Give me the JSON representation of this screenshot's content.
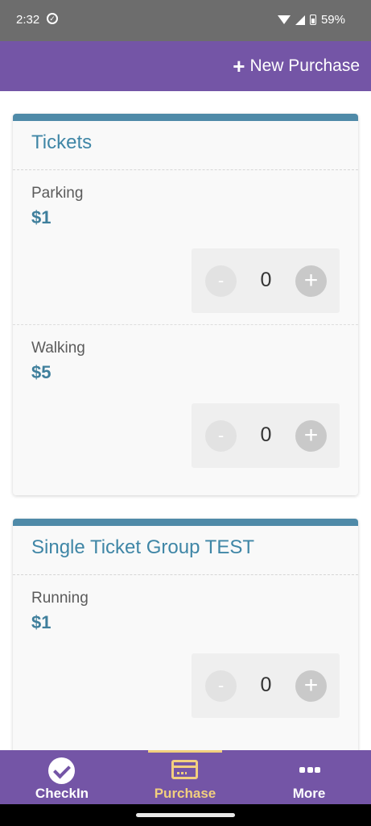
{
  "status_bar": {
    "time": "2:32",
    "battery": "59%"
  },
  "app_bar": {
    "new_purchase_label": "New Purchase"
  },
  "groups": [
    {
      "title": "Tickets",
      "items": [
        {
          "name": "Parking",
          "price": "$1",
          "quantity": "0"
        },
        {
          "name": "Walking",
          "price": "$5",
          "quantity": "0"
        }
      ]
    },
    {
      "title": "Single Ticket Group TEST",
      "items": [
        {
          "name": "Running",
          "price": "$1",
          "quantity": "0"
        }
      ]
    }
  ],
  "stepper": {
    "minus": "-",
    "plus": "+"
  },
  "bottom_nav": {
    "items": [
      {
        "label": "CheckIn",
        "icon": "check-circle-icon"
      },
      {
        "label": "Purchase",
        "icon": "credit-card-icon",
        "active": true
      },
      {
        "label": "More",
        "icon": "more-dots-icon"
      }
    ]
  },
  "colors": {
    "primary": "#7455a6",
    "accent": "#f2cf7e",
    "card_header": "#4f8aa8",
    "price": "#3f7f9c"
  }
}
